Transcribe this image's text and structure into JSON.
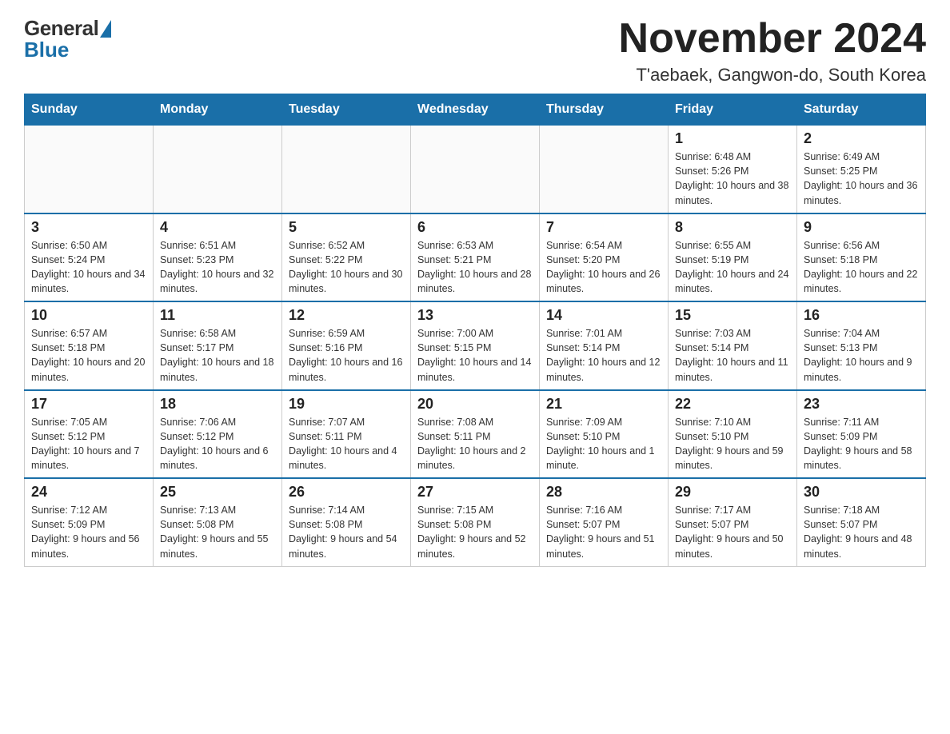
{
  "header": {
    "logo": {
      "general": "General",
      "blue": "Blue"
    },
    "title": "November 2024",
    "location": "T'aebaek, Gangwon-do, South Korea"
  },
  "weekdays": [
    "Sunday",
    "Monday",
    "Tuesday",
    "Wednesday",
    "Thursday",
    "Friday",
    "Saturday"
  ],
  "weeks": [
    [
      {
        "day": "",
        "info": ""
      },
      {
        "day": "",
        "info": ""
      },
      {
        "day": "",
        "info": ""
      },
      {
        "day": "",
        "info": ""
      },
      {
        "day": "",
        "info": ""
      },
      {
        "day": "1",
        "info": "Sunrise: 6:48 AM\nSunset: 5:26 PM\nDaylight: 10 hours and 38 minutes."
      },
      {
        "day": "2",
        "info": "Sunrise: 6:49 AM\nSunset: 5:25 PM\nDaylight: 10 hours and 36 minutes."
      }
    ],
    [
      {
        "day": "3",
        "info": "Sunrise: 6:50 AM\nSunset: 5:24 PM\nDaylight: 10 hours and 34 minutes."
      },
      {
        "day": "4",
        "info": "Sunrise: 6:51 AM\nSunset: 5:23 PM\nDaylight: 10 hours and 32 minutes."
      },
      {
        "day": "5",
        "info": "Sunrise: 6:52 AM\nSunset: 5:22 PM\nDaylight: 10 hours and 30 minutes."
      },
      {
        "day": "6",
        "info": "Sunrise: 6:53 AM\nSunset: 5:21 PM\nDaylight: 10 hours and 28 minutes."
      },
      {
        "day": "7",
        "info": "Sunrise: 6:54 AM\nSunset: 5:20 PM\nDaylight: 10 hours and 26 minutes."
      },
      {
        "day": "8",
        "info": "Sunrise: 6:55 AM\nSunset: 5:19 PM\nDaylight: 10 hours and 24 minutes."
      },
      {
        "day": "9",
        "info": "Sunrise: 6:56 AM\nSunset: 5:18 PM\nDaylight: 10 hours and 22 minutes."
      }
    ],
    [
      {
        "day": "10",
        "info": "Sunrise: 6:57 AM\nSunset: 5:18 PM\nDaylight: 10 hours and 20 minutes."
      },
      {
        "day": "11",
        "info": "Sunrise: 6:58 AM\nSunset: 5:17 PM\nDaylight: 10 hours and 18 minutes."
      },
      {
        "day": "12",
        "info": "Sunrise: 6:59 AM\nSunset: 5:16 PM\nDaylight: 10 hours and 16 minutes."
      },
      {
        "day": "13",
        "info": "Sunrise: 7:00 AM\nSunset: 5:15 PM\nDaylight: 10 hours and 14 minutes."
      },
      {
        "day": "14",
        "info": "Sunrise: 7:01 AM\nSunset: 5:14 PM\nDaylight: 10 hours and 12 minutes."
      },
      {
        "day": "15",
        "info": "Sunrise: 7:03 AM\nSunset: 5:14 PM\nDaylight: 10 hours and 11 minutes."
      },
      {
        "day": "16",
        "info": "Sunrise: 7:04 AM\nSunset: 5:13 PM\nDaylight: 10 hours and 9 minutes."
      }
    ],
    [
      {
        "day": "17",
        "info": "Sunrise: 7:05 AM\nSunset: 5:12 PM\nDaylight: 10 hours and 7 minutes."
      },
      {
        "day": "18",
        "info": "Sunrise: 7:06 AM\nSunset: 5:12 PM\nDaylight: 10 hours and 6 minutes."
      },
      {
        "day": "19",
        "info": "Sunrise: 7:07 AM\nSunset: 5:11 PM\nDaylight: 10 hours and 4 minutes."
      },
      {
        "day": "20",
        "info": "Sunrise: 7:08 AM\nSunset: 5:11 PM\nDaylight: 10 hours and 2 minutes."
      },
      {
        "day": "21",
        "info": "Sunrise: 7:09 AM\nSunset: 5:10 PM\nDaylight: 10 hours and 1 minute."
      },
      {
        "day": "22",
        "info": "Sunrise: 7:10 AM\nSunset: 5:10 PM\nDaylight: 9 hours and 59 minutes."
      },
      {
        "day": "23",
        "info": "Sunrise: 7:11 AM\nSunset: 5:09 PM\nDaylight: 9 hours and 58 minutes."
      }
    ],
    [
      {
        "day": "24",
        "info": "Sunrise: 7:12 AM\nSunset: 5:09 PM\nDaylight: 9 hours and 56 minutes."
      },
      {
        "day": "25",
        "info": "Sunrise: 7:13 AM\nSunset: 5:08 PM\nDaylight: 9 hours and 55 minutes."
      },
      {
        "day": "26",
        "info": "Sunrise: 7:14 AM\nSunset: 5:08 PM\nDaylight: 9 hours and 54 minutes."
      },
      {
        "day": "27",
        "info": "Sunrise: 7:15 AM\nSunset: 5:08 PM\nDaylight: 9 hours and 52 minutes."
      },
      {
        "day": "28",
        "info": "Sunrise: 7:16 AM\nSunset: 5:07 PM\nDaylight: 9 hours and 51 minutes."
      },
      {
        "day": "29",
        "info": "Sunrise: 7:17 AM\nSunset: 5:07 PM\nDaylight: 9 hours and 50 minutes."
      },
      {
        "day": "30",
        "info": "Sunrise: 7:18 AM\nSunset: 5:07 PM\nDaylight: 9 hours and 48 minutes."
      }
    ]
  ]
}
